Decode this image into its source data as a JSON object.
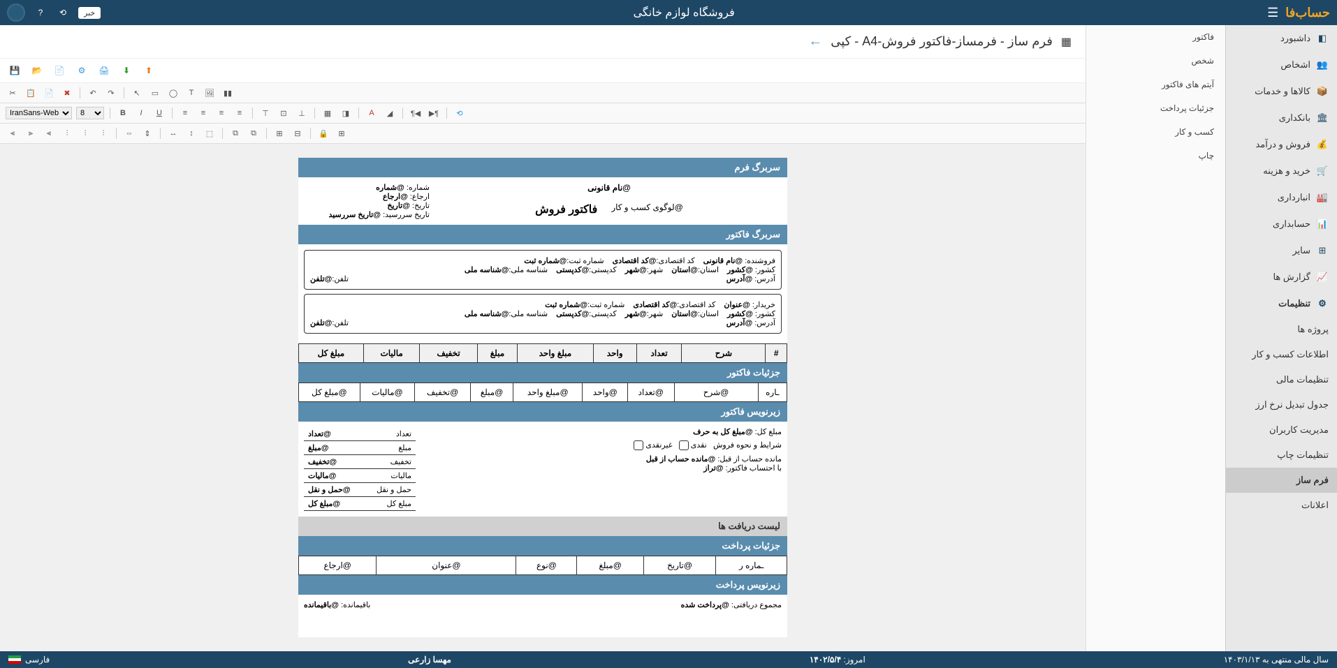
{
  "header": {
    "logo": "حساب‌فا",
    "company": "فروشگاه لوازم خانگی",
    "news_badge": "خبر"
  },
  "sidebar": {
    "items": [
      {
        "label": "داشبورد",
        "icon": "◧"
      },
      {
        "label": "اشخاص",
        "icon": "👥"
      },
      {
        "label": "کالاها و خدمات",
        "icon": "📦"
      },
      {
        "label": "بانکداری",
        "icon": "🏛"
      },
      {
        "label": "فروش و درآمد",
        "icon": "💰"
      },
      {
        "label": "خرید و هزینه",
        "icon": "🛒"
      },
      {
        "label": "انبارداری",
        "icon": "🏭"
      },
      {
        "label": "حسابداری",
        "icon": "📊"
      },
      {
        "label": "سایر",
        "icon": "⊞"
      },
      {
        "label": "گزارش ها",
        "icon": "📈"
      }
    ],
    "settings_label": "تنظیمات",
    "settings_items": [
      "پروژه ها",
      "اطلاعات کسب و کار",
      "تنظیمات مالی",
      "جدول تبدیل نرخ ارز",
      "مدیریت کاربران",
      "تنظیمات چاپ",
      "فرم ساز",
      "اعلانات"
    ]
  },
  "submenu": {
    "items": [
      "فاکتور",
      "شخص",
      "آیتم های فاکتور",
      "جزئیات پرداخت",
      "کسب و کار",
      "چاپ"
    ]
  },
  "page": {
    "title": "فرم ساز - فرمساز-فاکتور فروش-A4 - کپی"
  },
  "toolbar": {
    "font": "IranSans-Web",
    "font_size": "8"
  },
  "form": {
    "header_section": "سربرگ فرم",
    "legal_name": "@نام قانونی",
    "business_logo": "@لوگوی کسب و کار",
    "doc_title": "فاکتور فروش",
    "number_label": "شماره:",
    "number_value": "@شماره",
    "reference_label": "ارجاع:",
    "reference_value": "@ارجاع",
    "date_label": "تاریخ:",
    "date_value": "@تاریخ",
    "duedate_label": "تاریخ سررسید:",
    "duedate_value": "@تاریخ سررسید",
    "invoice_header": "سربرگ فاکتور",
    "seller_label": "فروشنده:",
    "seller_value": "@نام قانونی",
    "buyer_label": "خریدار:",
    "buyer_value": "@عنوان",
    "country_label": "کشور:",
    "country_value": "@کشور",
    "province_label": "استان:",
    "province_value": "@استان",
    "city_label": "شهر:",
    "city_value": "@شهر",
    "postal_label": "کدپستی:",
    "postal_value": "@کدپستی",
    "address_label": "آدرس:",
    "address_value": "@آدرس",
    "eco_code_label": "کد اقتصادی:",
    "eco_code_value": "@کد اقتصادی",
    "reg_num_label": "شماره ثبت:",
    "reg_num_value": "@شماره ثبت",
    "national_label": "شناسه ملی:",
    "national_value": "@شناسه ملی",
    "phone_label": "تلفن:",
    "phone_value": "@تلفن",
    "table_headers": [
      "#",
      "شرح",
      "تعداد",
      "واحد",
      "مبلغ واحد",
      "مبلغ",
      "تخفیف",
      "مالیات",
      "مبلغ کل"
    ],
    "details_header": "جزئیات فاکتور",
    "row_values": [
      "ـاره",
      "@شرح",
      "@تعداد",
      "@واحد",
      "@مبلغ واحد",
      "@مبلغ",
      "@تخفیف",
      "@مالیات",
      "@مبلغ کل"
    ],
    "subtitle_header": "زیرنویس فاکتور",
    "total_words_label": "مبلغ کل:",
    "total_words_value": "@مبلغ کل به حرف",
    "payment_terms": "شرایط و نحوه فروش",
    "cash": "نقدی",
    "noncash": "غیرنقدی",
    "prev_balance_label": "مانده حساب از قبل:",
    "prev_balance_value": "@مانده حساب از قبل",
    "with_invoice_label": "با احتساب فاکتور:",
    "with_invoice_value": "@تراز",
    "summary": {
      "count_label": "تعداد",
      "count_value": "@تعداد",
      "amount_label": "مبلغ",
      "amount_value": "@مبلغ",
      "discount_label": "تخفیف",
      "discount_value": "@تخفیف",
      "tax_label": "مالیات",
      "tax_value": "@مالیات",
      "shipping_label": "حمل و نقل",
      "shipping_value": "@حمل و نقل",
      "total_label": "مبلغ کل",
      "total_value": "@مبلغ کل"
    },
    "receipts_header": "لیست دریافت ها",
    "payment_details_header": "جزئیات پرداخت",
    "payment_row": {
      "num": "ـماره ر",
      "date": "@تاریخ",
      "amount": "@مبلغ",
      "type": "@نوع",
      "title": "@عنوان",
      "ref": "@ارجاع"
    },
    "payment_subtitle": "زیرنویس پرداخت",
    "total_received_label": "مجموع دریافتی:",
    "total_received_value": "@پرداخت شده",
    "remaining_label": "باقیمانده:",
    "remaining_value": "@باقیمانده"
  },
  "footer": {
    "today_label": "امروز:",
    "today_value": "۱۴۰۲/۵/۴",
    "user": "مهسا زارعی",
    "fiscal_year": "سال مالی منتهی به ۱۴۰۳/۱/۱۳",
    "language": "فارسی"
  }
}
